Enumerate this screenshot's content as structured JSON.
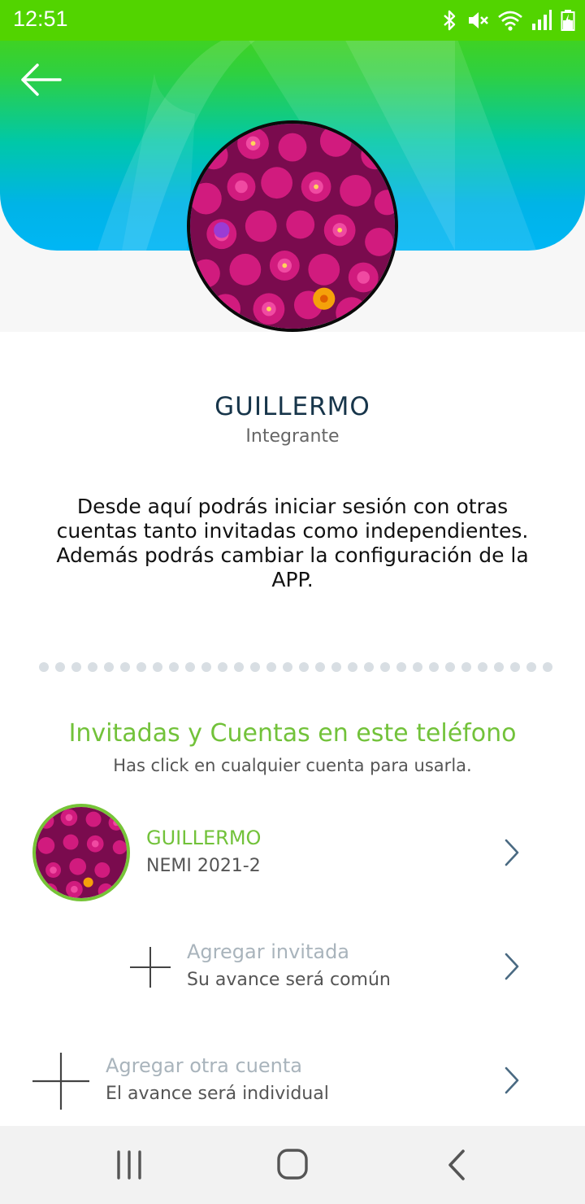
{
  "status_bar": {
    "time": "12:51",
    "icons": [
      "bluetooth-icon",
      "mute-icon",
      "wifi-icon",
      "signal-icon",
      "battery-icon"
    ]
  },
  "header": {
    "back_icon": "arrow-left-icon"
  },
  "profile": {
    "name": "GUILLERMO",
    "role": "Integrante",
    "description": "Desde aquí podrás iniciar sesión con otras cuentas tanto invitadas como independientes. Además podrás cambiar la configuración de la APP."
  },
  "accounts": {
    "title": "Invitadas y Cuentas en este teléfono",
    "subtitle": "Has click en cualquier cuenta para usarla.",
    "current": {
      "name": "GUILLERMO",
      "group": "NEMI 2021-2"
    },
    "add_guest": {
      "label": "Agregar invitada",
      "note": "Su avance será común"
    },
    "add_account": {
      "label": "Agregar otra cuenta",
      "note": "El avance será individual"
    }
  },
  "nav_bar": {
    "buttons": [
      "recents-icon",
      "home-icon",
      "back-icon"
    ]
  },
  "colors": {
    "status_green": "#52d400",
    "accent_green": "#72c23a",
    "name_dark": "#17354a",
    "muted_gray": "#a9b4bc",
    "banner_blue": "#00b6f5"
  }
}
